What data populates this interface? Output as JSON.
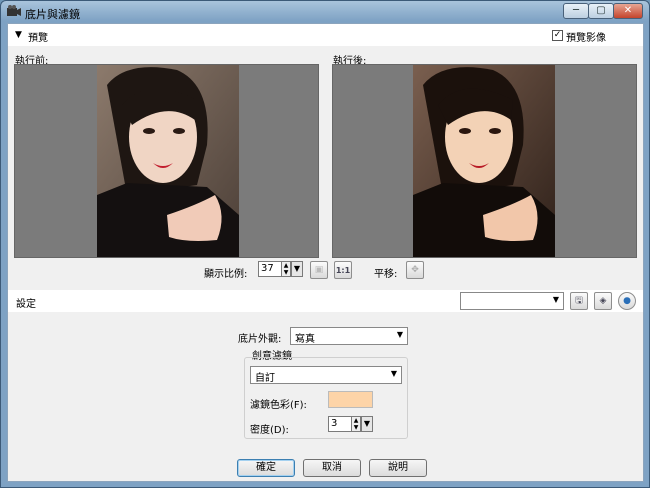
{
  "window": {
    "title": "底片與濾鏡",
    "controls": {
      "minimize": "─",
      "maximize": "▢",
      "close": "✕"
    }
  },
  "preview": {
    "header": "預覽",
    "preview_image_label": "預覽影像",
    "preview_image_checked": true,
    "before_label": "執行前:",
    "after_label": "執行後:",
    "zoom_label": "顯示比例:",
    "zoom_value": "37",
    "pan_label": "平移:",
    "actual_size_label": "1:1"
  },
  "settings": {
    "header": "設定",
    "preset_value": "",
    "film_look_label": "底片外觀:",
    "film_look_value": "寫真",
    "creative_filter_group": "創意濾鏡",
    "filter_preset_value": "自訂",
    "filter_color_label": "濾鏡色彩(F):",
    "filter_color": "#fdd4a8",
    "density_label": "密度(D):",
    "density_value": "3"
  },
  "buttons": {
    "ok": "確定",
    "cancel": "取消",
    "help": "說明"
  }
}
